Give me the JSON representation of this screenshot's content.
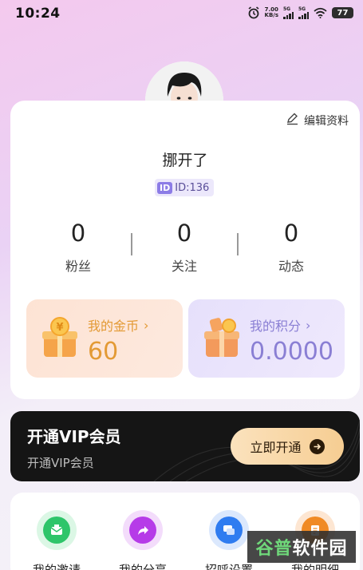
{
  "status_bar": {
    "time": "10:24",
    "net_speed_value": "7.00",
    "net_speed_unit": "KB/s",
    "sim1": "5G",
    "sim2": "5G",
    "battery": "77"
  },
  "profile": {
    "edit_label": "编辑资料",
    "nickname": "挪开了",
    "id_mark": "ID",
    "id_text": "ID:136"
  },
  "stats": [
    {
      "value": "0",
      "label": "粉丝"
    },
    {
      "value": "0",
      "label": "关注"
    },
    {
      "value": "0",
      "label": "动态"
    }
  ],
  "coins": {
    "title": "我的金币",
    "chevron": "›",
    "value": "60"
  },
  "points": {
    "title": "我的积分",
    "chevron": "›",
    "value": "0.0000"
  },
  "vip": {
    "title": "开通VIP会员",
    "subtitle": "开通VIP会员",
    "button_label": "立即开通"
  },
  "menu": [
    {
      "label": "我的邀请",
      "icon": "invite-icon",
      "color": "#2ec56a"
    },
    {
      "label": "我的分享",
      "icon": "share-icon",
      "color": "#b63be8"
    },
    {
      "label": "招呼设置",
      "icon": "chat-icon",
      "color": "#2f7cf0"
    },
    {
      "label": "我的明细",
      "icon": "detail-icon",
      "color": "#f08a24"
    }
  ],
  "watermark": {
    "part1": "谷普",
    "part2": "软件园"
  }
}
